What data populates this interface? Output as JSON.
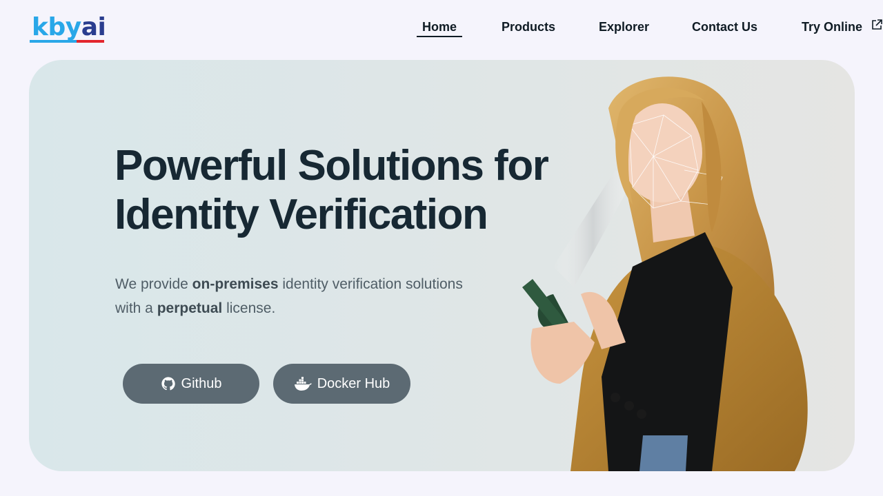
{
  "header": {
    "logo": {
      "text_left": "kby",
      "text_right": "ai",
      "brand_blue": "#29a7e8",
      "brand_navy": "#2a3d8f",
      "brand_red": "#e3262e"
    },
    "nav": [
      {
        "label": "Home",
        "active": true
      },
      {
        "label": "Products"
      },
      {
        "label": "Explorer"
      },
      {
        "label": "Contact Us"
      },
      {
        "label": "Try Online",
        "icon": "external-link-icon"
      }
    ]
  },
  "hero": {
    "title_line1": "Powerful Solutions for",
    "title_line2": "Identity Verification",
    "desc": {
      "p1": "We provide ",
      "b1": "on-premises",
      "p2": " identity verification solutions",
      "p3": "with a ",
      "b2": "perpetual",
      "p4": " license."
    },
    "buttons": [
      {
        "label": "Github",
        "icon": "github-icon"
      },
      {
        "label": "Docker Hub",
        "icon": "docker-icon"
      }
    ],
    "image": {
      "subject": "woman-with-phone-face-mesh"
    }
  },
  "colors": {
    "page_bg": "#f5f4fc",
    "hero_bg": "#dde7e8",
    "title": "#172833",
    "button_bg": "#5c6a73"
  }
}
